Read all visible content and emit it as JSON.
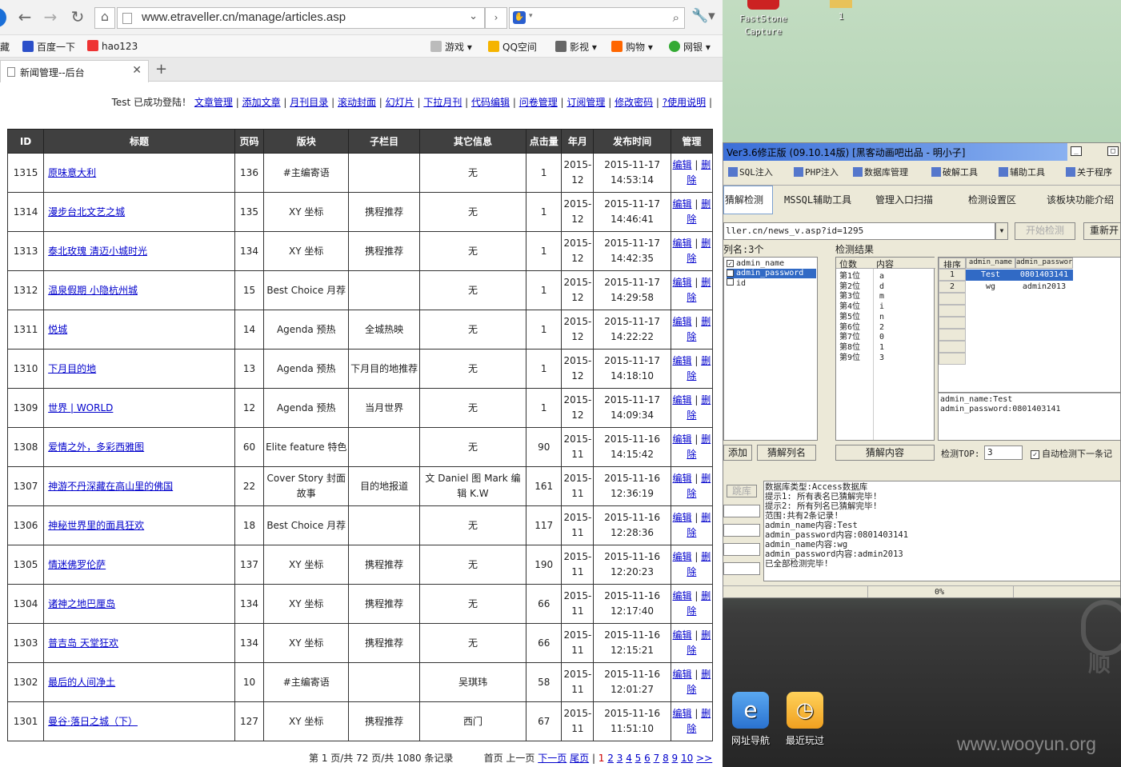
{
  "browser": {
    "url": "www.etraveller.cn/manage/articles.asp",
    "bookmarks": [
      "藏",
      "百度一下",
      "hao123",
      "游戏",
      "QQ空间",
      "影视",
      "购物",
      "网银"
    ],
    "tab_title": "新闻管理--后台"
  },
  "topnav": {
    "login_text": "Test 已成功登陆！",
    "links": [
      "文章管理",
      "添加文章",
      "月刊目录",
      "滚动封面",
      "幻灯片",
      "下拉月刊",
      "代码编辑",
      "问卷管理",
      "订阅管理",
      "修改密码",
      "?使用说明"
    ]
  },
  "table": {
    "headers": [
      "ID",
      "标题",
      "页码",
      "版块",
      "子栏目",
      "其它信息",
      "点击量",
      "年月",
      "发布时间",
      "管理"
    ],
    "edit_label": "编辑",
    "delete_label": "删除",
    "rows": [
      [
        "1315",
        "原味意大利",
        "136",
        "#主编寄语",
        "",
        "无",
        "1",
        "2015-12",
        "2015-11-17 14:53:14"
      ],
      [
        "1314",
        "漫步台北文艺之城",
        "135",
        "XY 坐标",
        "携程推荐",
        "无",
        "1",
        "2015-12",
        "2015-11-17 14:46:41"
      ],
      [
        "1313",
        "泰北玫瑰 清迈小城时光",
        "134",
        "XY 坐标",
        "携程推荐",
        "无",
        "1",
        "2015-12",
        "2015-11-17 14:42:35"
      ],
      [
        "1312",
        "温泉假期 小隐杭州城",
        "15",
        "Best Choice 月荐",
        "",
        "无",
        "1",
        "2015-12",
        "2015-11-17 14:29:58"
      ],
      [
        "1311",
        "悦城",
        "14",
        "Agenda 预热",
        "全城热映",
        "无",
        "1",
        "2015-12",
        "2015-11-17 14:22:22"
      ],
      [
        "1310",
        "下月目的地",
        "13",
        "Agenda 预热",
        "下月目的地推荐",
        "无",
        "1",
        "2015-12",
        "2015-11-17 14:18:10"
      ],
      [
        "1309",
        "世界 | WORLD",
        "12",
        "Agenda 预热",
        "当月世界",
        "无",
        "1",
        "2015-12",
        "2015-11-17 14:09:34"
      ],
      [
        "1308",
        "爱情之外，多彩西雅图",
        "60",
        "Elite feature 特色",
        "",
        "无",
        "90",
        "2015-11",
        "2015-11-16 14:15:42"
      ],
      [
        "1307",
        "神游不丹深藏在高山里的佛国",
        "22",
        "Cover Story 封面故事",
        "目的地报道",
        "文 Daniel 图 Mark 编辑 K.W",
        "161",
        "2015-11",
        "2015-11-16 12:36:19"
      ],
      [
        "1306",
        "神秘世界里的面具狂欢",
        "18",
        "Best Choice 月荐",
        "",
        "无",
        "117",
        "2015-11",
        "2015-11-16 12:28:36"
      ],
      [
        "1305",
        "情迷佛罗伦萨",
        "137",
        "XY 坐标",
        "携程推荐",
        "无",
        "190",
        "2015-11",
        "2015-11-16 12:20:23"
      ],
      [
        "1304",
        "诸神之地巴厘岛",
        "134",
        "XY 坐标",
        "携程推荐",
        "无",
        "66",
        "2015-11",
        "2015-11-16 12:17:40"
      ],
      [
        "1303",
        "普吉岛 天堂狂欢",
        "134",
        "XY 坐标",
        "携程推荐",
        "无",
        "66",
        "2015-11",
        "2015-11-16 12:15:21"
      ],
      [
        "1302",
        "最后的人间净土",
        "10",
        "#主编寄语",
        "",
        "吴琪玮",
        "58",
        "2015-11",
        "2015-11-16 12:01:27"
      ],
      [
        "1301",
        "曼谷·落日之城（下）",
        "127",
        "XY 坐标",
        "携程推荐",
        "西门",
        "67",
        "2015-11",
        "2015-11-16 11:51:10"
      ]
    ]
  },
  "pager": {
    "summary": "第 1 页/共 72 页/共 1080 条记录",
    "first": "首页",
    "prev": "上一页",
    "next": "下一页",
    "last": "尾页",
    "pages": [
      "1",
      "2",
      "3",
      "4",
      "5",
      "6",
      "7",
      "8",
      "9",
      "10"
    ],
    "more": ">>"
  },
  "desktop": {
    "top_icon_label": "FastStone Capture",
    "top_icon2_label": "1",
    "bottom_icons": [
      "网址导航",
      "最近玩过"
    ],
    "logo_char": "顺",
    "watermark": "www.wooyun.org"
  },
  "tool": {
    "title": "Ver3.6修正版 (09.10.14版) [黑客动画吧出品 - 明小子]",
    "menu_tabs": [
      "SQL注入",
      "PHP注入",
      "数据库管理",
      "破解工具",
      "辅助工具",
      "关于程序"
    ],
    "sub_tabs": [
      "猜解检测",
      "MSSQL辅助工具",
      "管理入口扫描",
      "检测设置区",
      "该板块功能介绍"
    ],
    "url_field": "ller.cn/news_v.asp?id=1295",
    "start_btn": "开始检测",
    "restart_btn": "重新开",
    "cols_label": "列名:3个",
    "results_label": "检测结果",
    "columns": [
      {
        "name": "admin_name",
        "checked": true
      },
      {
        "name": "admin_password",
        "checked": true
      },
      {
        "name": "id",
        "checked": false
      }
    ],
    "pos_header": "位数",
    "content_header": "内容",
    "positions": [
      "第1位",
      "第2位",
      "第3位",
      "第4位",
      "第5位",
      "第6位",
      "第7位",
      "第8位",
      "第9位"
    ],
    "chars": [
      "a",
      "d",
      "m",
      "i",
      "n",
      "2",
      "0",
      "1",
      "3"
    ],
    "grid_headers": [
      "排序",
      "admin_name",
      "admin_passwor"
    ],
    "grid_rows": [
      [
        "1",
        "Test",
        "0801403141"
      ],
      [
        "2",
        "wg",
        "admin2013"
      ]
    ],
    "summary_lines": [
      "admin_name:Test",
      "admin_password:0801403141"
    ],
    "btn_add": "添加",
    "btn_guess_cols": "猜解列名",
    "btn_guess_content": "猜解内容",
    "top_label": "检测TOP:",
    "top_value": "3",
    "auto_label": "自动检测下一条记",
    "log_lines": [
      "数据库类型:Access数据库",
      "提示1: 所有表名已猜解完毕!",
      "提示2: 所有列名已猜解完毕!",
      "范围:共有2条记录!",
      "admin_name内容:Test",
      "admin_password内容:0801403141",
      "admin_name内容:wg",
      "admin_password内容:admin2013",
      "已全部检测完毕!"
    ],
    "progress_text": "0%",
    "side_btn": "跳库"
  }
}
